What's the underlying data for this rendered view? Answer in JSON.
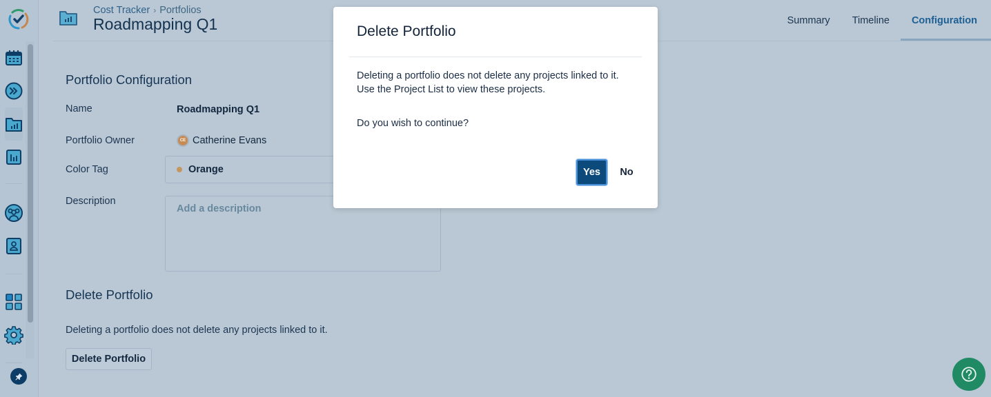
{
  "header": {
    "breadcrumb": [
      "Cost Tracker",
      "Portfolios"
    ],
    "breadcrumb_separator": "›",
    "title": "Roadmapping Q1",
    "tabs": [
      {
        "label": "Summary",
        "active": false
      },
      {
        "label": "Timeline",
        "active": false
      },
      {
        "label": "Configuration",
        "active": true
      }
    ]
  },
  "sidebar": {
    "items": [
      {
        "icon": "app-logo-icon"
      },
      {
        "icon": "calendar-icon"
      },
      {
        "icon": "fast-forward-icon"
      },
      {
        "icon": "portfolio-folder-icon",
        "active": true
      },
      {
        "icon": "report-chart-icon"
      },
      {
        "icon": "team-icon"
      },
      {
        "icon": "user-card-icon"
      },
      {
        "icon": "dashboard-grid-icon"
      },
      {
        "icon": "settings-gear-icon"
      },
      {
        "icon": "pin-icon"
      }
    ]
  },
  "config": {
    "section_title": "Portfolio Configuration",
    "name_label": "Name",
    "name_value": "Roadmapping Q1",
    "owner_label": "Portfolio Owner",
    "owner_initials": "CE",
    "owner_name": "Catherine Evans",
    "color_label": "Color Tag",
    "color_value": "Orange",
    "color_hex": "#c49660",
    "description_label": "Description",
    "description_placeholder": "Add a description",
    "description_value": ""
  },
  "delete_section": {
    "title": "Delete Portfolio",
    "note": "Deleting a portfolio does not delete any projects linked to it.",
    "button_label": "Delete Portfolio"
  },
  "modal": {
    "title": "Delete Portfolio",
    "body_line1": "Deleting a portfolio does not delete any projects linked to it.",
    "body_line2": "Use the Project List to view these projects.",
    "question": "Do you wish to continue?",
    "yes_label": "Yes",
    "no_label": "No"
  },
  "colors": {
    "primary": "#0d4a7c",
    "accent_tab": "#1b5f93",
    "help_fab": "#1f8a63",
    "overlay_bg": "#bac8d5"
  }
}
